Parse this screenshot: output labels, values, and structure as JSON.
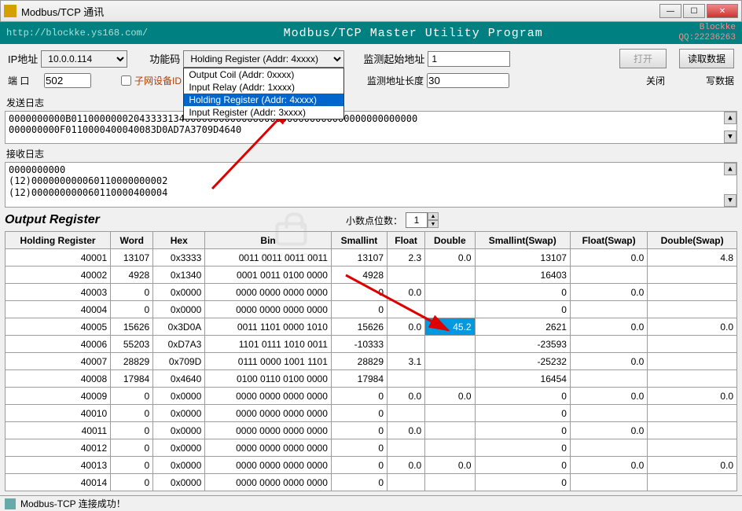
{
  "window": {
    "title": "Modbus/TCP 通讯"
  },
  "header": {
    "url": "http://blockke.ys168.com/",
    "program": "Modbus/TCP  Master Utility Program",
    "author": "Blockke",
    "qq": "QQ:22236263"
  },
  "controls": {
    "ip_label": "IP地址",
    "ip_value": "10.0.0.114",
    "port_label": "端 口",
    "port_value": "502",
    "subnet_label": "子网设备ID",
    "func_label": "功能码",
    "func_selected": "Holding Register (Addr: 4xxxx)",
    "func_options": [
      "Output Coil (Addr: 0xxxx)",
      "Input Relay (Addr: 1xxxx)",
      "Holding Register (Addr: 4xxxx)",
      "Input Register (Addr: 3xxxx)"
    ],
    "start_label": "监测起始地址",
    "start_value": "1",
    "len_label": "监测地址长度",
    "len_value": "30",
    "btn_open": "打开",
    "btn_read": "读取数据",
    "btn_close": "关闭",
    "btn_write": "写数据"
  },
  "send_log": {
    "title": "发送日志",
    "line1": "0000000000B0110000000204333313400000000000000000000000000000000000000000",
    "line2": "000000000F0110000400040083D0AD7A3709D4640"
  },
  "recv_log": {
    "title": "接收日志",
    "line1": "0000000000",
    "line2": "(12)000000000060110000000002",
    "line3": "(12)000000000060110000400004"
  },
  "output": {
    "title": "Output Register",
    "decimal_label": "小数点位数：",
    "decimal_value": "1",
    "headers": [
      "Holding Register",
      "Word",
      "Hex",
      "Bin",
      "Smallint",
      "Float",
      "Double",
      "Smallint(Swap)",
      "Float(Swap)",
      "Double(Swap)"
    ],
    "rows": [
      {
        "addr": "40001",
        "word": "13107",
        "hex": "0x3333",
        "bin": "0011 0011 0011 0011",
        "si": "13107",
        "f": "2.3",
        "d": "0.0",
        "sis": "13107",
        "fs": "0.0",
        "ds": "4.8"
      },
      {
        "addr": "40002",
        "word": "4928",
        "hex": "0x1340",
        "bin": "0001 0011 0100 0000",
        "si": "4928",
        "f": "",
        "d": "",
        "sis": "16403",
        "fs": "",
        "ds": ""
      },
      {
        "addr": "40003",
        "word": "0",
        "hex": "0x0000",
        "bin": "0000 0000 0000 0000",
        "si": "0",
        "f": "0.0",
        "d": "",
        "sis": "0",
        "fs": "0.0",
        "ds": ""
      },
      {
        "addr": "40004",
        "word": "0",
        "hex": "0x0000",
        "bin": "0000 0000 0000 0000",
        "si": "0",
        "f": "",
        "d": "",
        "sis": "0",
        "fs": "",
        "ds": ""
      },
      {
        "addr": "40005",
        "word": "15626",
        "hex": "0x3D0A",
        "bin": "0011 1101 0000 1010",
        "si": "15626",
        "f": "0.0",
        "d": "45.2",
        "sis": "2621",
        "fs": "0.0",
        "ds": "0.0",
        "hl_d": true
      },
      {
        "addr": "40006",
        "word": "55203",
        "hex": "0xD7A3",
        "bin": "1101 0111 1010 0011",
        "si": "-10333",
        "f": "",
        "d": "",
        "sis": "-23593",
        "fs": "",
        "ds": ""
      },
      {
        "addr": "40007",
        "word": "28829",
        "hex": "0x709D",
        "bin": "0111 0000 1001 1101",
        "si": "28829",
        "f": "3.1",
        "d": "",
        "sis": "-25232",
        "fs": "0.0",
        "ds": ""
      },
      {
        "addr": "40008",
        "word": "17984",
        "hex": "0x4640",
        "bin": "0100 0110 0100 0000",
        "si": "17984",
        "f": "",
        "d": "",
        "sis": "16454",
        "fs": "",
        "ds": ""
      },
      {
        "addr": "40009",
        "word": "0",
        "hex": "0x0000",
        "bin": "0000 0000 0000 0000",
        "si": "0",
        "f": "0.0",
        "d": "0.0",
        "sis": "0",
        "fs": "0.0",
        "ds": "0.0"
      },
      {
        "addr": "40010",
        "word": "0",
        "hex": "0x0000",
        "bin": "0000 0000 0000 0000",
        "si": "0",
        "f": "",
        "d": "",
        "sis": "0",
        "fs": "",
        "ds": ""
      },
      {
        "addr": "40011",
        "word": "0",
        "hex": "0x0000",
        "bin": "0000 0000 0000 0000",
        "si": "0",
        "f": "0.0",
        "d": "",
        "sis": "0",
        "fs": "0.0",
        "ds": ""
      },
      {
        "addr": "40012",
        "word": "0",
        "hex": "0x0000",
        "bin": "0000 0000 0000 0000",
        "si": "0",
        "f": "",
        "d": "",
        "sis": "0",
        "fs": "",
        "ds": ""
      },
      {
        "addr": "40013",
        "word": "0",
        "hex": "0x0000",
        "bin": "0000 0000 0000 0000",
        "si": "0",
        "f": "0.0",
        "d": "0.0",
        "sis": "0",
        "fs": "0.0",
        "ds": "0.0"
      },
      {
        "addr": "40014",
        "word": "0",
        "hex": "0x0000",
        "bin": "0000 0000 0000 0000",
        "si": "0",
        "f": "",
        "d": "",
        "sis": "0",
        "fs": "",
        "ds": ""
      }
    ]
  },
  "status": "Modbus-TCP 连接成功！"
}
